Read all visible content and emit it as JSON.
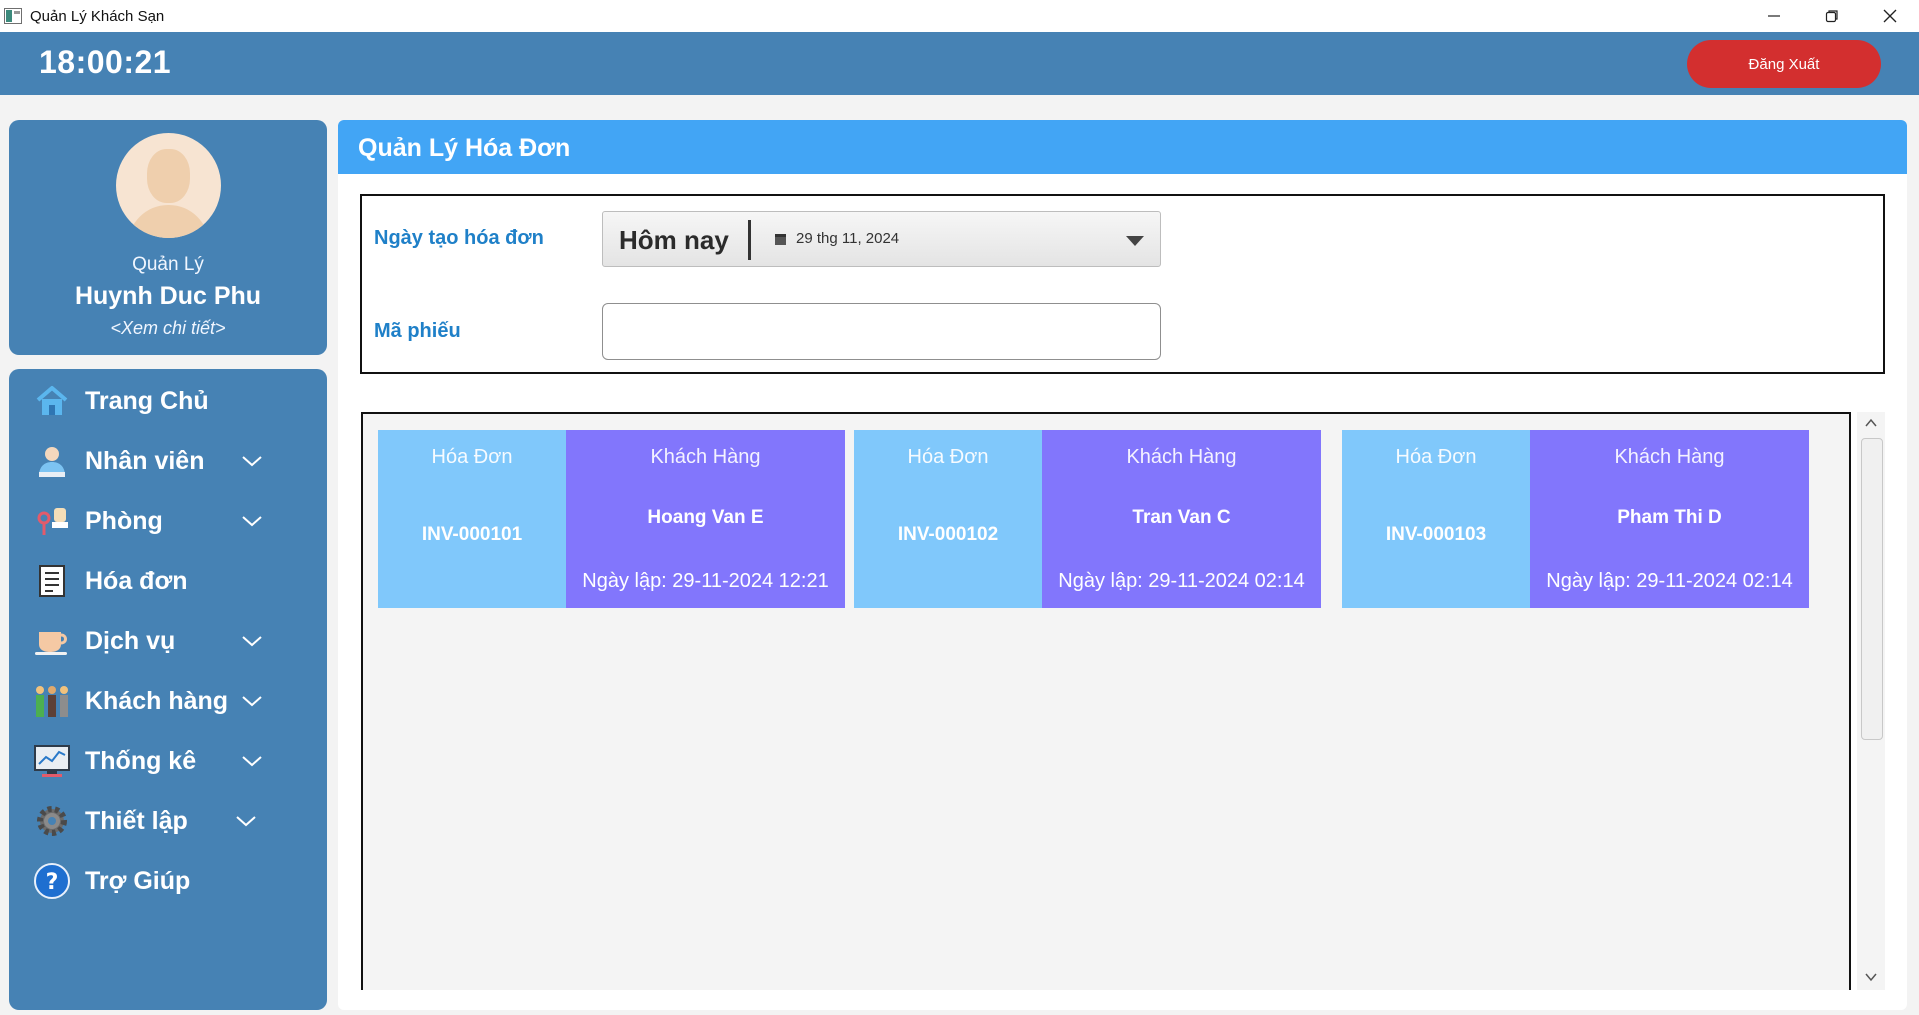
{
  "window": {
    "title": "Quản Lý Khách Sạn"
  },
  "topbar": {
    "clock": "18:00:21",
    "logout_label": "Đăng Xuất"
  },
  "profile": {
    "role": "Quản Lý",
    "name": "Huynh Duc Phu",
    "detail_link": "<Xem chi tiết>"
  },
  "nav": {
    "items": [
      {
        "label": "Trang Chủ",
        "icon": "home-icon",
        "expandable": false
      },
      {
        "label": "Nhân viên",
        "icon": "employee-icon",
        "expandable": true
      },
      {
        "label": "Phòng",
        "icon": "room-key-icon",
        "expandable": true
      },
      {
        "label": "Hóa đơn",
        "icon": "invoice-icon",
        "expandable": false
      },
      {
        "label": "Dịch vụ",
        "icon": "coffee-cup-icon",
        "expandable": true
      },
      {
        "label": "Khách hàng",
        "icon": "customers-icon",
        "expandable": true
      },
      {
        "label": "Thống kê",
        "icon": "statistics-monitor-icon",
        "expandable": true
      },
      {
        "label": "Thiết lập",
        "icon": "gear-icon",
        "expandable": true
      },
      {
        "label": "Trợ Giúp",
        "icon": "help-icon",
        "expandable": false
      }
    ]
  },
  "main": {
    "title": "Quản Lý Hóa Đơn",
    "filter": {
      "date_label": "Ngày tạo hóa đơn",
      "date_preset": "Hôm nay",
      "date_value": "29 thg 11, 2024",
      "ticket_label": "Mã phiếu",
      "ticket_value": ""
    },
    "invoices": [
      {
        "invoice_header": "Hóa Đơn",
        "invoice_id": "INV-000101",
        "customer_header": "Khách Hàng",
        "customer_name": "Hoang Van E",
        "created": "Ngày lập: 29-11-2024 12:21"
      },
      {
        "invoice_header": "Hóa Đơn",
        "invoice_id": "INV-000102",
        "customer_header": "Khách Hàng",
        "customer_name": "Tran Van C",
        "created": "Ngày lập: 29-11-2024 02:14"
      },
      {
        "invoice_header": "Hóa Đơn",
        "invoice_id": "INV-000103",
        "customer_header": "Khách Hàng",
        "customer_name": "Pham Thi D",
        "created": "Ngày lập: 29-11-2024 02:14"
      }
    ]
  },
  "colors": {
    "primary": "#4682b4",
    "header": "#42a5f5",
    "logout": "#d32f2f",
    "invoice_card": "#80c8fb",
    "customer_card": "#8276fc",
    "label_blue": "#1f80c8"
  }
}
